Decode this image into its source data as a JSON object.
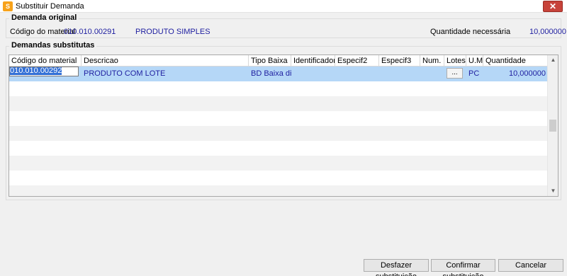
{
  "window": {
    "title": "Substituir Demanda",
    "close_glyph": "✕"
  },
  "original": {
    "group_title": "Demanda original",
    "codigo_label": "Código do material",
    "codigo_value": "010.010.00291",
    "descricao_value": "PRODUTO SIMPLES",
    "quantidade_label": "Quantidade necessária",
    "quantidade_value": "10,000000"
  },
  "substitutas": {
    "group_title": "Demandas substitutas",
    "columns": [
      "Código do material",
      "Descricao",
      "Tipo Baixa",
      "Identificador",
      "Especif2",
      "Especif3",
      "Num.",
      "Lotes",
      "U.M.",
      "Quantidade"
    ],
    "rows": [
      {
        "codigo": "010.010.00292",
        "descricao": "PRODUTO COM LOTE",
        "tipo_baixa": "BD Baixa diretz",
        "identificador": "",
        "especif2": "",
        "especif3": "",
        "num": "",
        "lotes_button": "...",
        "um": "PC",
        "quantidade": "10,000000"
      }
    ]
  },
  "buttons": {
    "desfazer": "Desfazer substituição",
    "confirmar": "Confirmar substituição",
    "cancelar": "Cancelar"
  },
  "icons": {
    "app": "app-logo-icon",
    "close": "close-icon",
    "scroll_up": "chevron-up-icon",
    "scroll_down": "chevron-down-icon"
  },
  "colors": {
    "value_text": "#1e1ea0",
    "selection": "#b5d7f7",
    "close": "#c7433a"
  }
}
